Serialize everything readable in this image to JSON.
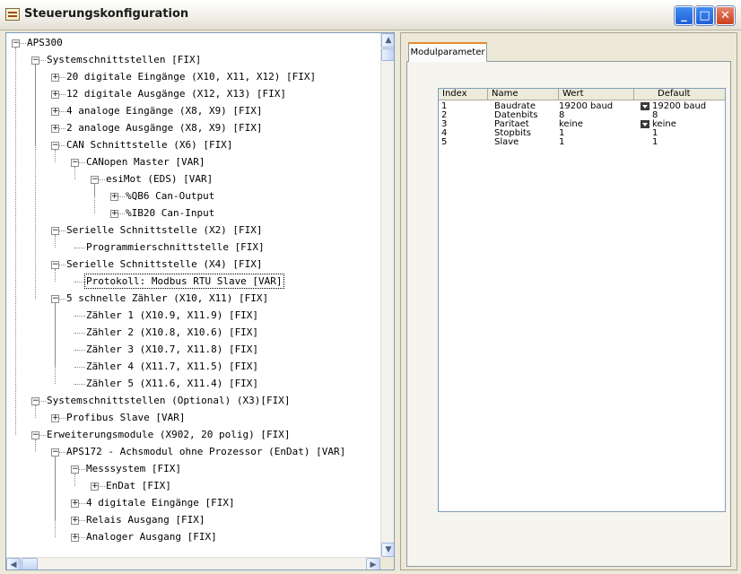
{
  "window": {
    "title": "Steuerungskonfiguration",
    "minimize": "_",
    "maximize": "□",
    "close": "✕"
  },
  "tree": {
    "nodes": [
      {
        "label": "APS300",
        "level": 0,
        "expander": "minus"
      },
      {
        "label": "Systemschnittstellen [FIX]",
        "level": 1,
        "expander": "minus"
      },
      {
        "label": "20 digitale Eingänge (X10, X11, X12) [FIX]",
        "level": 2,
        "expander": "plus"
      },
      {
        "label": "12 digitale Ausgänge (X12, X13) [FIX]",
        "level": 2,
        "expander": "plus"
      },
      {
        "label": "4 analoge Eingänge (X8, X9) [FIX]",
        "level": 2,
        "expander": "plus"
      },
      {
        "label": "2 analoge Ausgänge (X8, X9) [FIX]",
        "level": 2,
        "expander": "plus"
      },
      {
        "label": "CAN Schnittstelle (X6) [FIX]",
        "level": 2,
        "expander": "minus"
      },
      {
        "label": "CANopen Master [VAR]",
        "level": 3,
        "expander": "minus"
      },
      {
        "label": "esiMot (EDS)  [VAR]",
        "level": 4,
        "expander": "minus"
      },
      {
        "label": "%QB6 Can-Output",
        "level": 5,
        "expander": "plus"
      },
      {
        "label": "%IB20 Can-Input",
        "level": 5,
        "expander": "plus"
      },
      {
        "label": "Serielle Schnittstelle (X2) [FIX]",
        "level": 2,
        "expander": "minus"
      },
      {
        "label": "Programmierschnittstelle [FIX]",
        "level": 3,
        "expander": "none"
      },
      {
        "label": "Serielle Schnittstelle (X4) [FIX]",
        "level": 2,
        "expander": "minus"
      },
      {
        "label": "Protokoll: Modbus RTU Slave [VAR]",
        "level": 3,
        "expander": "none",
        "selected": true
      },
      {
        "label": "5 schnelle Zähler (X10, X11) [FIX]",
        "level": 2,
        "expander": "minus"
      },
      {
        "label": "Zähler 1 (X10.9, X11.9) [FIX]",
        "level": 3,
        "expander": "none"
      },
      {
        "label": "Zähler 2 (X10.8, X10.6) [FIX]",
        "level": 3,
        "expander": "none"
      },
      {
        "label": "Zähler 3 (X10.7, X11.8) [FIX]",
        "level": 3,
        "expander": "none"
      },
      {
        "label": "Zähler 4 (X11.7, X11.5) [FIX]",
        "level": 3,
        "expander": "none"
      },
      {
        "label": "Zähler 5 (X11.6, X11.4) [FIX]",
        "level": 3,
        "expander": "none"
      },
      {
        "label": "Systemschnittstellen (Optional) (X3)[FIX]",
        "level": 1,
        "expander": "minus"
      },
      {
        "label": "Profibus Slave [VAR]",
        "level": 2,
        "expander": "plus"
      },
      {
        "label": "Erweiterungsmodule (X902, 20 polig) [FIX]",
        "level": 1,
        "expander": "minus"
      },
      {
        "label": "APS172 - Achsmodul ohne Prozessor (EnDat) [VAR]",
        "level": 2,
        "expander": "minus"
      },
      {
        "label": "Messsystem [FIX]",
        "level": 3,
        "expander": "minus"
      },
      {
        "label": "EnDat [FIX]",
        "level": 4,
        "expander": "plus"
      },
      {
        "label": "4 digitale Eingänge [FIX]",
        "level": 3,
        "expander": "plus"
      },
      {
        "label": "Relais Ausgang [FIX]",
        "level": 3,
        "expander": "plus"
      },
      {
        "label": "Analoger Ausgang [FIX]",
        "level": 3,
        "expander": "plus"
      }
    ]
  },
  "tabs": [
    {
      "label": "Modulparameter",
      "active": true
    }
  ],
  "parameter_grid": {
    "columns": [
      "Index",
      "Name",
      "Wert",
      "Default"
    ],
    "rows": [
      {
        "index": "1",
        "name": "Baudrate",
        "value": "19200 baud",
        "dropdown": true,
        "default": "19200 baud"
      },
      {
        "index": "2",
        "name": "Datenbits",
        "value": "8",
        "dropdown": false,
        "default": "8"
      },
      {
        "index": "3",
        "name": "Paritaet",
        "value": "keine",
        "dropdown": true,
        "default": "keine"
      },
      {
        "index": "4",
        "name": "Stopbits",
        "value": "1",
        "dropdown": false,
        "default": "1"
      },
      {
        "index": "5",
        "name": "Slave",
        "value": "1",
        "dropdown": false,
        "default": "1"
      }
    ]
  }
}
